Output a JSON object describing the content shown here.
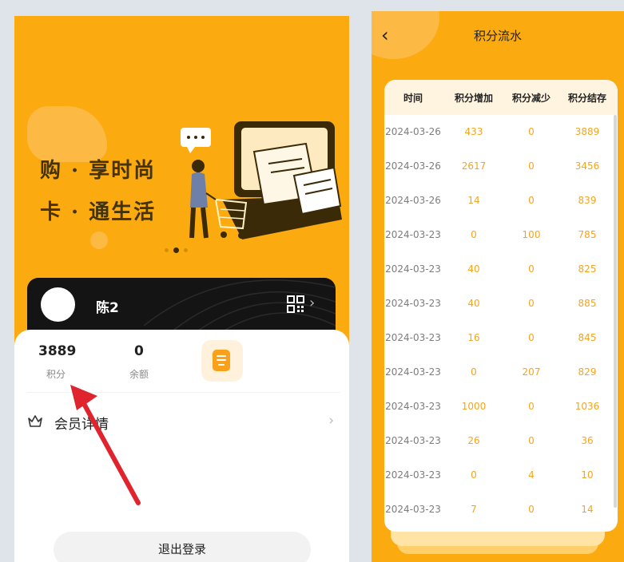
{
  "left": {
    "slogan": {
      "line1": "购 · 享时尚",
      "line2": "卡 · 通生活"
    },
    "member": {
      "name": "陈2"
    },
    "stats": {
      "points_value": "3889",
      "points_label": "积分",
      "balance_value": "0",
      "balance_label": "余额"
    },
    "menu": {
      "member_details": "会员详情"
    },
    "logout_label": "退出登录",
    "colors": {
      "brand": "#fbab0f",
      "card": "#141414",
      "arrow": "#e0242e"
    }
  },
  "right": {
    "title": "积分流水",
    "headers": [
      "时间",
      "积分增加",
      "积分减少",
      "积分结存"
    ],
    "rows": [
      [
        "2024-03-26",
        "433",
        "0",
        "3889"
      ],
      [
        "2024-03-26",
        "2617",
        "0",
        "3456"
      ],
      [
        "2024-03-26",
        "14",
        "0",
        "839"
      ],
      [
        "2024-03-23",
        "0",
        "100",
        "785"
      ],
      [
        "2024-03-23",
        "40",
        "0",
        "825"
      ],
      [
        "2024-03-23",
        "40",
        "0",
        "885"
      ],
      [
        "2024-03-23",
        "16",
        "0",
        "845"
      ],
      [
        "2024-03-23",
        "0",
        "207",
        "829"
      ],
      [
        "2024-03-23",
        "1000",
        "0",
        "1036"
      ],
      [
        "2024-03-23",
        "26",
        "0",
        "36"
      ],
      [
        "2024-03-23",
        "0",
        "4",
        "10"
      ],
      [
        "2024-03-23",
        "7",
        "0",
        "14"
      ]
    ],
    "colors": {
      "accent": "#f4a51f",
      "header_bg": "#fff4e0"
    }
  }
}
